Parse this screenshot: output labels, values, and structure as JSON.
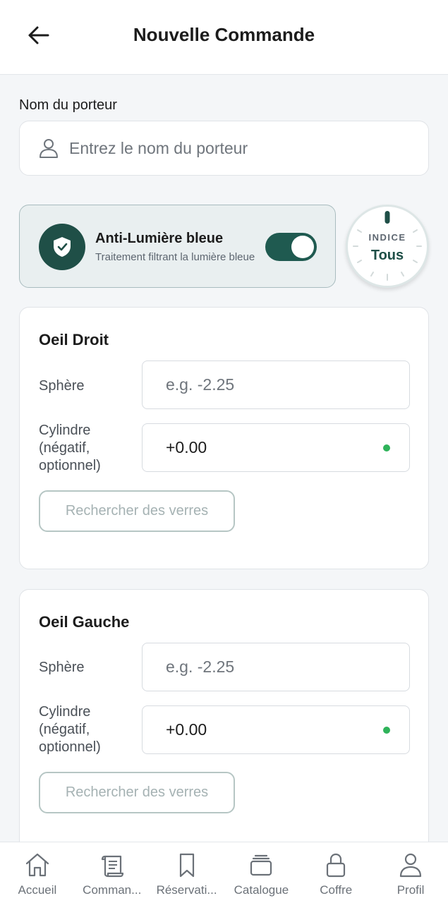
{
  "header": {
    "title": "Nouvelle Commande",
    "back_icon": "arrow-left-icon"
  },
  "wearer": {
    "label": "Nom du porteur",
    "placeholder": "Entrez le nom du porteur",
    "value": ""
  },
  "blue_light": {
    "title": "Anti-Lumière bleue",
    "subtitle": "Traitement filtrant la lumière bleue",
    "enabled": true,
    "icon": "shield-check-icon"
  },
  "indice": {
    "label": "INDICE",
    "value": "Tous"
  },
  "right_eye": {
    "title": "Oeil Droit",
    "sphere_label": "Sphère",
    "sphere_placeholder": "e.g. -2.25",
    "sphere_value": "",
    "cylinder_label_line1": "Cylindre",
    "cylinder_label_line2": "(négatif,",
    "cylinder_label_line3": "optionnel)",
    "cylinder_value": "+0.00",
    "search_button": "Rechercher des verres"
  },
  "left_eye": {
    "title": "Oeil Gauche",
    "sphere_label": "Sphère",
    "sphere_placeholder": "e.g. -2.25",
    "sphere_value": "",
    "cylinder_label_line1": "Cylindre",
    "cylinder_label_line2": "(négatif,",
    "cylinder_label_line3": "optionnel)",
    "cylinder_value": "+0.00",
    "search_button": "Rechercher des verres"
  },
  "nav": {
    "items": [
      {
        "label": "Accueil",
        "icon": "home-icon"
      },
      {
        "label": "Comman...",
        "icon": "receipt-icon"
      },
      {
        "label": "Réservati...",
        "icon": "bookmark-icon"
      },
      {
        "label": "Catalogue",
        "icon": "stack-icon"
      },
      {
        "label": "Coffre",
        "icon": "lock-icon"
      },
      {
        "label": "Profil",
        "icon": "user-icon"
      }
    ]
  },
  "colors": {
    "accent": "#1f4f47",
    "toggle_on": "#1f5a50",
    "valid_dot": "#2fb35a",
    "background": "#f4f6f8"
  }
}
